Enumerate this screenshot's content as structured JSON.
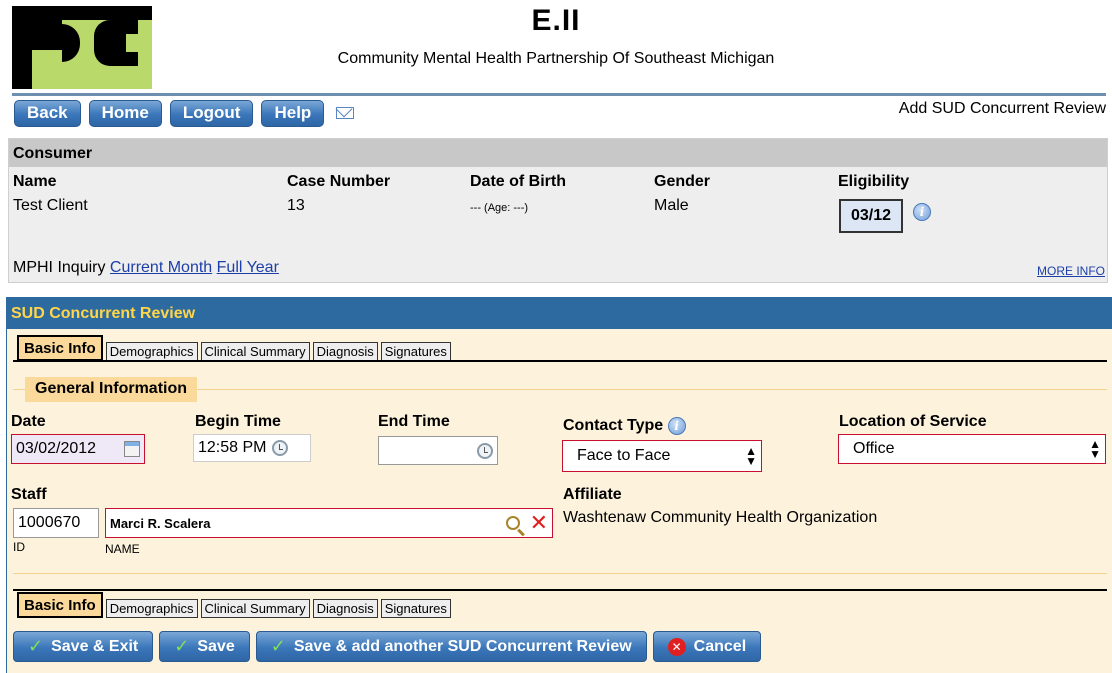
{
  "header": {
    "title": "E.II",
    "subtitle": "Community Mental Health Partnership Of Southeast Michigan"
  },
  "nav": {
    "back": "Back",
    "home": "Home",
    "logout": "Logout",
    "help": "Help",
    "page_heading": "Add SUD Concurrent Review"
  },
  "consumer": {
    "section_title": "Consumer",
    "name_label": "Name",
    "name_value": "Test Client",
    "case_label": "Case Number",
    "case_value": "13",
    "dob_label": "Date of Birth",
    "dob_value": "--- (Age: ---)",
    "gender_label": "Gender",
    "gender_value": "Male",
    "eligibility_label": "Eligibility",
    "eligibility_value": "03/12",
    "mphi_label": "MPHI Inquiry",
    "current_month": "Current Month",
    "full_year": "Full Year",
    "more_info": "MORE INFO"
  },
  "sud": {
    "title": "SUD Concurrent Review",
    "tabs": [
      "Basic Info",
      "Demographics",
      "Clinical Summary",
      "Diagnosis",
      "Signatures"
    ],
    "general_info": "General Information",
    "date_label": "Date",
    "date_value": "03/02/2012",
    "begin_label": "Begin Time",
    "begin_value": "12:58 PM",
    "end_label": "End Time",
    "end_value": "",
    "contact_label": "Contact Type",
    "contact_value": "Face to Face",
    "location_label": "Location of Service",
    "location_value": "Office",
    "staff_label": "Staff",
    "staff_id": "1000670",
    "staff_name": "Marci R. Scalera",
    "id_caption": "ID",
    "name_caption": "NAME",
    "affiliate_label": "Affiliate",
    "affiliate_value": "Washtenaw Community Health Organization"
  },
  "actions": {
    "save_exit": "Save & Exit",
    "save": "Save",
    "save_another": "Save & add another SUD Concurrent Review",
    "cancel": "Cancel"
  },
  "colors": {
    "nav_blue": "#3a76b9",
    "panel_header_blue": "#2c6aa0",
    "panel_header_text": "#ffd54a",
    "panel_bg": "#fdf3dd",
    "required_red": "#c8102e",
    "logo_green": "#b9d96a"
  }
}
